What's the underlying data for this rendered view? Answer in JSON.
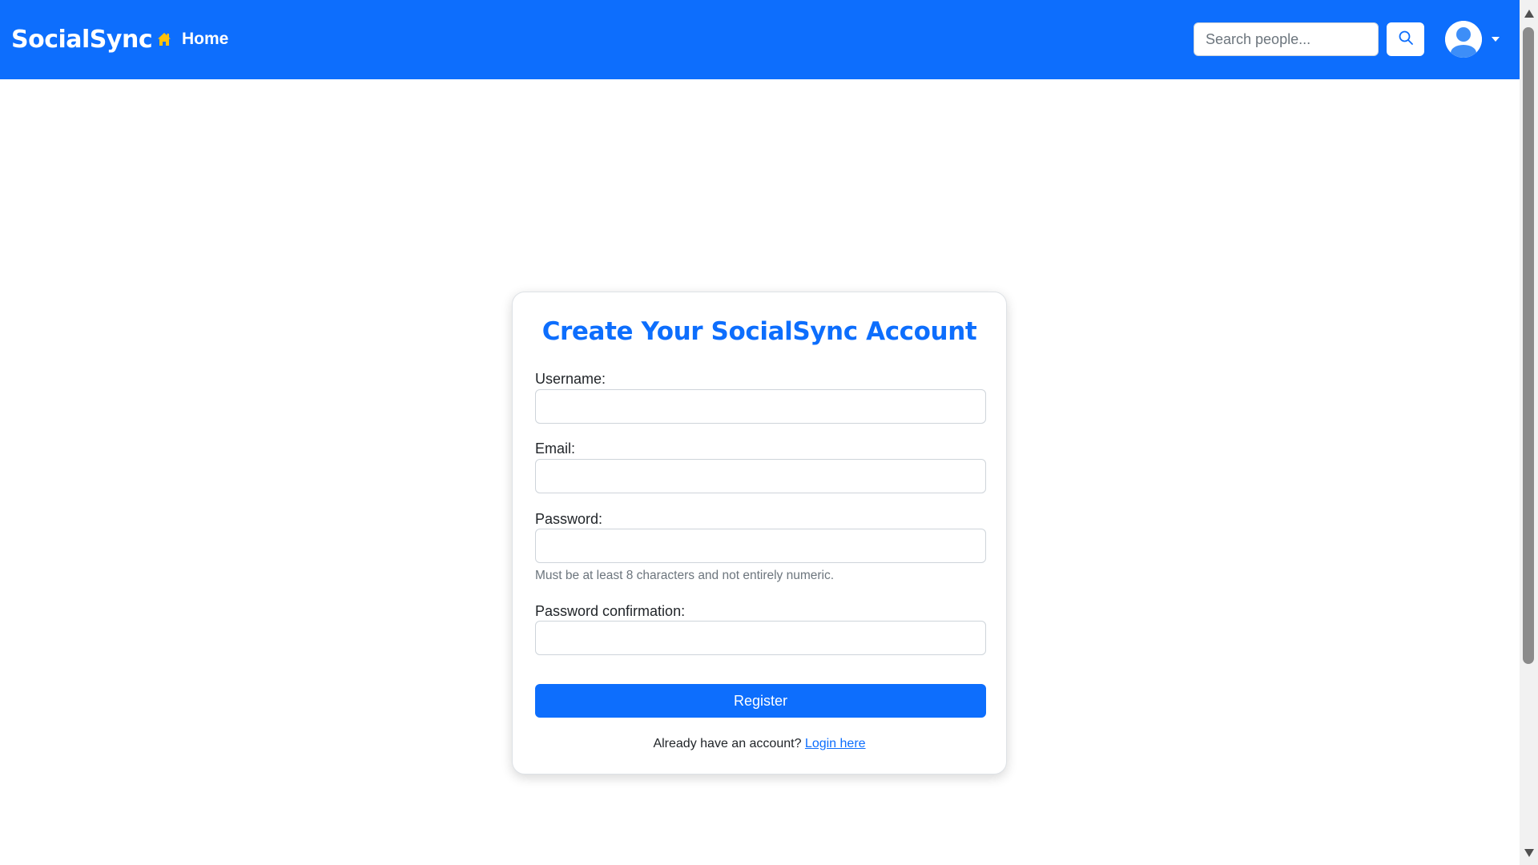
{
  "navbar": {
    "brand": "SocialSync",
    "home_label": "Home",
    "search_placeholder": "Search people..."
  },
  "form": {
    "title": "Create Your SocialSync Account",
    "username_label": "Username:",
    "email_label": "Email:",
    "password_label": "Password:",
    "password_help": "Must be at least 8 characters and not entirely numeric.",
    "password_confirm_label": "Password confirmation:",
    "submit_label": "Register",
    "login_prompt": "Already have an account?",
    "login_link": "Login here"
  },
  "colors": {
    "primary": "#0d6efd",
    "home_icon": "#ffc107",
    "muted_text": "#6c757d",
    "border": "#ced4da"
  },
  "icons": [
    "home-icon",
    "search-icon",
    "user-avatar-icon",
    "caret-down-icon"
  ]
}
